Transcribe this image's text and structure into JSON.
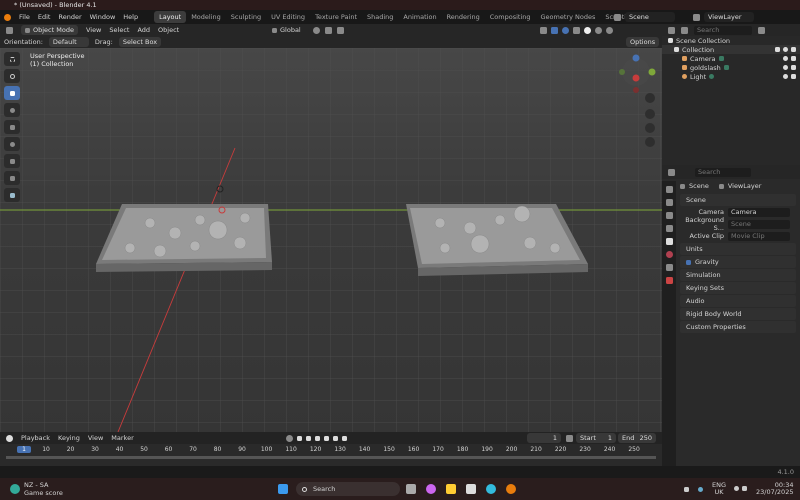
{
  "window": {
    "title": "* (Unsaved) - Blender 4.1",
    "controls": [
      "—",
      "❐",
      "✕"
    ]
  },
  "menu": [
    "File",
    "Edit",
    "Render",
    "Window",
    "Help"
  ],
  "workspaces": [
    "Layout",
    "Modeling",
    "Sculpting",
    "UV Editing",
    "Texture Paint",
    "Shading",
    "Animation",
    "Rendering",
    "Compositing",
    "Geometry Nodes",
    "Scripting",
    "+"
  ],
  "header": {
    "scene": "Scene",
    "view_layer": "ViewLayer"
  },
  "viewport_header": {
    "mode": "Object Mode",
    "menus": [
      "View",
      "Select",
      "Add",
      "Object"
    ],
    "transform": "Global"
  },
  "tool_settings": {
    "orientation_label": "Orientation:",
    "orientation": "Default",
    "drag_label": "Drag:",
    "drag": "Select Box",
    "options": "Options"
  },
  "viewport": {
    "perspective": "User Perspective",
    "collection": "(1) Collection",
    "colors": {
      "x_axis": "#c83c3c",
      "y_axis": "#7fa83a",
      "bg": "#3c3c3c"
    }
  },
  "outliner": {
    "search_placeholder": "Search",
    "root": "Scene Collection",
    "collection": "Collection",
    "items": [
      "Camera",
      "goldslash",
      "Light"
    ]
  },
  "properties": {
    "search_placeholder": "Search",
    "breadcrumb": [
      "Scene",
      "ViewLayer"
    ],
    "section": "Scene",
    "fields": [
      {
        "label": "Camera",
        "value": "Camera"
      },
      {
        "label": "Background S...",
        "value": "Scene"
      },
      {
        "label": "Active Clip",
        "value": "Movie Clip"
      }
    ],
    "panels": [
      "Units",
      "Gravity",
      "Simulation",
      "Keying Sets",
      "Audio",
      "Rigid Body World",
      "Custom Properties"
    ]
  },
  "timeline": {
    "menus": [
      "Playback",
      "Keying",
      "View",
      "Marker"
    ],
    "current_frame": "1",
    "start_label": "Start",
    "start": "1",
    "end_label": "End",
    "end": "250",
    "ticks": [
      "1",
      "10",
      "20",
      "30",
      "40",
      "50",
      "60",
      "70",
      "80",
      "90",
      "100",
      "110",
      "120",
      "130",
      "140",
      "150",
      "160",
      "170",
      "180",
      "190",
      "200",
      "210",
      "220",
      "230",
      "240",
      "250"
    ]
  },
  "status": {
    "version": "4.1.0"
  },
  "taskbar": {
    "widget_title": "NZ - SA",
    "widget_sub": "Game score",
    "search": "Search",
    "lang": "ENG",
    "region": "UK",
    "time": "00:34",
    "date": "23/07/2025"
  }
}
